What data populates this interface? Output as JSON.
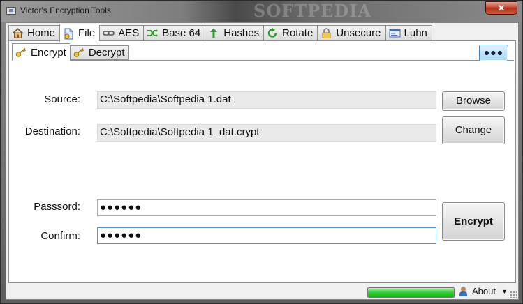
{
  "window": {
    "title": "Victor's Encryption Tools",
    "close_label": "✕",
    "watermark": "SOFTPEDIA"
  },
  "tabs": [
    {
      "label": "Home",
      "icon": "home-icon"
    },
    {
      "label": "File",
      "icon": "file-icon",
      "active": true
    },
    {
      "label": "AES",
      "icon": "chain-link-icon"
    },
    {
      "label": "Base 64",
      "icon": "shuffle-icon"
    },
    {
      "label": "Hashes",
      "icon": "hash-arrow-icon"
    },
    {
      "label": "Rotate",
      "icon": "rotate-icon"
    },
    {
      "label": "Unsecure",
      "icon": "padlock-icon"
    },
    {
      "label": "Luhn",
      "icon": "card-icon"
    }
  ],
  "subtabs": [
    {
      "label": "Encrypt",
      "icon": "key-icon",
      "active": true
    },
    {
      "label": "Decrypt",
      "icon": "key-icon"
    }
  ],
  "more_button": "●●●",
  "form": {
    "source_label": "Source:",
    "source_value": "C:\\Softpedia\\Softpedia 1.dat",
    "destination_label": "Destination:",
    "destination_value": "C:\\Softpedia\\Softpedia 1_dat.crypt",
    "browse_label": "Browse",
    "change_label": "Change",
    "password_label": "Passsord:",
    "password_value": "●●●●●●",
    "confirm_label": "Confirm:",
    "confirm_value": "●●●●●●",
    "encrypt_label": "Encrypt"
  },
  "status": {
    "progress": 1.0,
    "about_label": "About",
    "about_caret": "▼"
  },
  "colors": {
    "progress": "#2fd12f",
    "accent": "#3c7fb1"
  }
}
